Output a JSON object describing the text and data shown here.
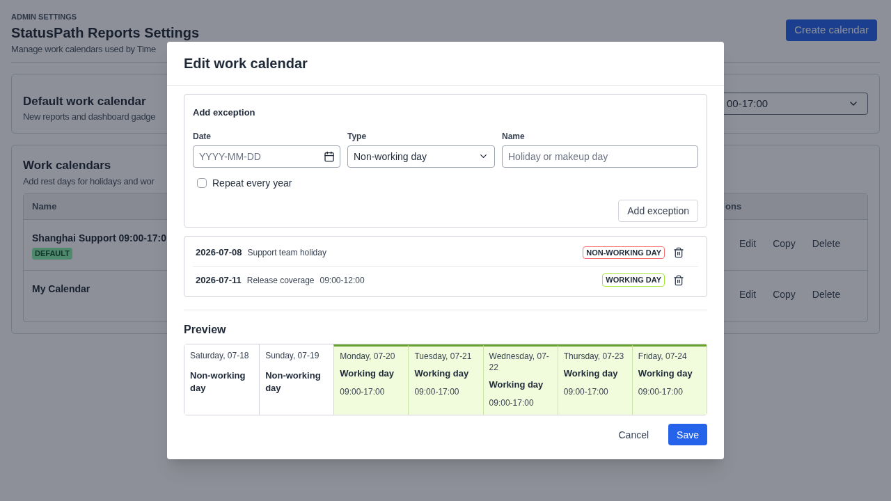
{
  "page": {
    "eyebrow": "ADMIN SETTINGS",
    "title": "StatusPath Reports Settings",
    "subtitle": "Manage work calendars used by Time",
    "create_button": "Create calendar"
  },
  "default_card": {
    "title": "Default work calendar",
    "description": "New reports and dashboard gadge",
    "select_value": "00-17:00"
  },
  "calendars_card": {
    "title": "Work calendars",
    "description": "Add rest days for holidays and wor",
    "columns": [
      "Name",
      "ons"
    ],
    "rows": [
      {
        "name": "Shanghai Support 09:00-17:0",
        "badge": "DEFAULT",
        "actions": [
          "Edit",
          "Copy",
          "Delete"
        ]
      },
      {
        "name": "My Calendar",
        "actions": [
          "Edit",
          "Copy",
          "Delete"
        ]
      }
    ]
  },
  "dialog": {
    "title": "Edit work calendar",
    "add_exception": {
      "title": "Add exception",
      "date": {
        "label": "Date",
        "placeholder": "YYYY-MM-DD"
      },
      "type": {
        "label": "Type",
        "value": "Non-working day"
      },
      "name": {
        "label": "Name",
        "placeholder": "Holiday or makeup day"
      },
      "repeat": {
        "label": "Repeat every year",
        "checked": false
      },
      "button": "Add exception"
    },
    "exceptions": [
      {
        "date": "2026-07-08",
        "name": "Support team holiday",
        "tag": "NON-WORKING DAY",
        "kind": "non-working"
      },
      {
        "date": "2026-07-11",
        "name": "Release coverage",
        "hours": "09:00-12:00",
        "tag": "WORKING DAY",
        "kind": "working"
      }
    ],
    "preview": {
      "title": "Preview",
      "days": [
        {
          "date": "Saturday, 07-18",
          "status": "Non-working day",
          "working": false
        },
        {
          "date": "Sunday, 07-19",
          "status": "Non-working day",
          "working": false
        },
        {
          "date": "Monday, 07-20",
          "status": "Working day",
          "hours": "09:00-17:00",
          "working": true
        },
        {
          "date": "Tuesday, 07-21",
          "status": "Working day",
          "hours": "09:00-17:00",
          "working": true
        },
        {
          "date": "Wednesday, 07-22",
          "status": "Working day",
          "hours": "09:00-17:00",
          "working": true
        },
        {
          "date": "Thursday, 07-23",
          "status": "Working day",
          "hours": "09:00-17:00",
          "working": true
        },
        {
          "date": "Friday, 07-24",
          "status": "Working day",
          "hours": "09:00-17:00",
          "working": true
        }
      ]
    },
    "cancel": "Cancel",
    "save": "Save"
  }
}
